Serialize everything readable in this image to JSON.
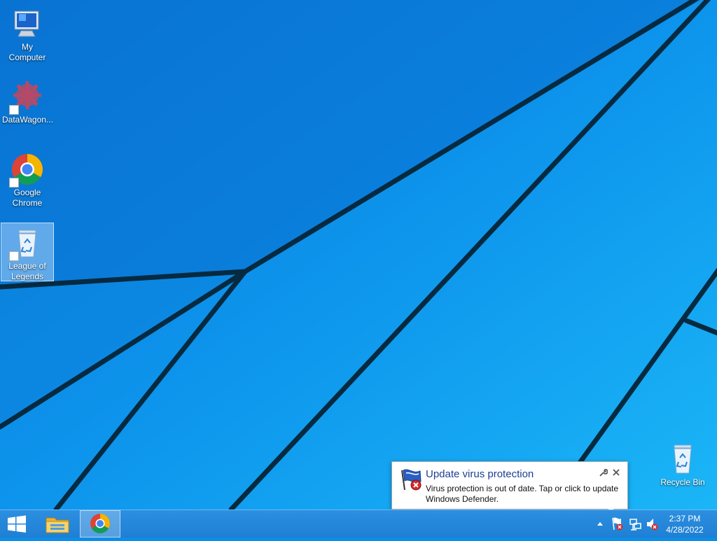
{
  "desktop": {
    "icons": [
      {
        "label": "My Computer"
      },
      {
        "label": "DataWagon..."
      },
      {
        "label": "Google Chrome"
      },
      {
        "label": "League of Legends"
      },
      {
        "label": "Recycle Bin"
      }
    ]
  },
  "notification": {
    "title": "Update virus protection",
    "message": "Virus protection is out of date. Tap or click to update Windows Defender.",
    "icon": "defender-flag-error-icon"
  },
  "taskbar": {
    "pinned": [
      "start-icon",
      "file-explorer-icon",
      "chrome-icon"
    ],
    "tray_icons": [
      "show-hidden-icons-icon",
      "action-center-error-icon",
      "network-icon",
      "volume-muted-icon"
    ],
    "time": "2:37 PM",
    "date": "4/28/2022"
  },
  "colors": {
    "wallpaper_blue": "#0b8ee8",
    "taskbar_blue": "#2185d8",
    "balloon_title": "#1c3f94"
  }
}
